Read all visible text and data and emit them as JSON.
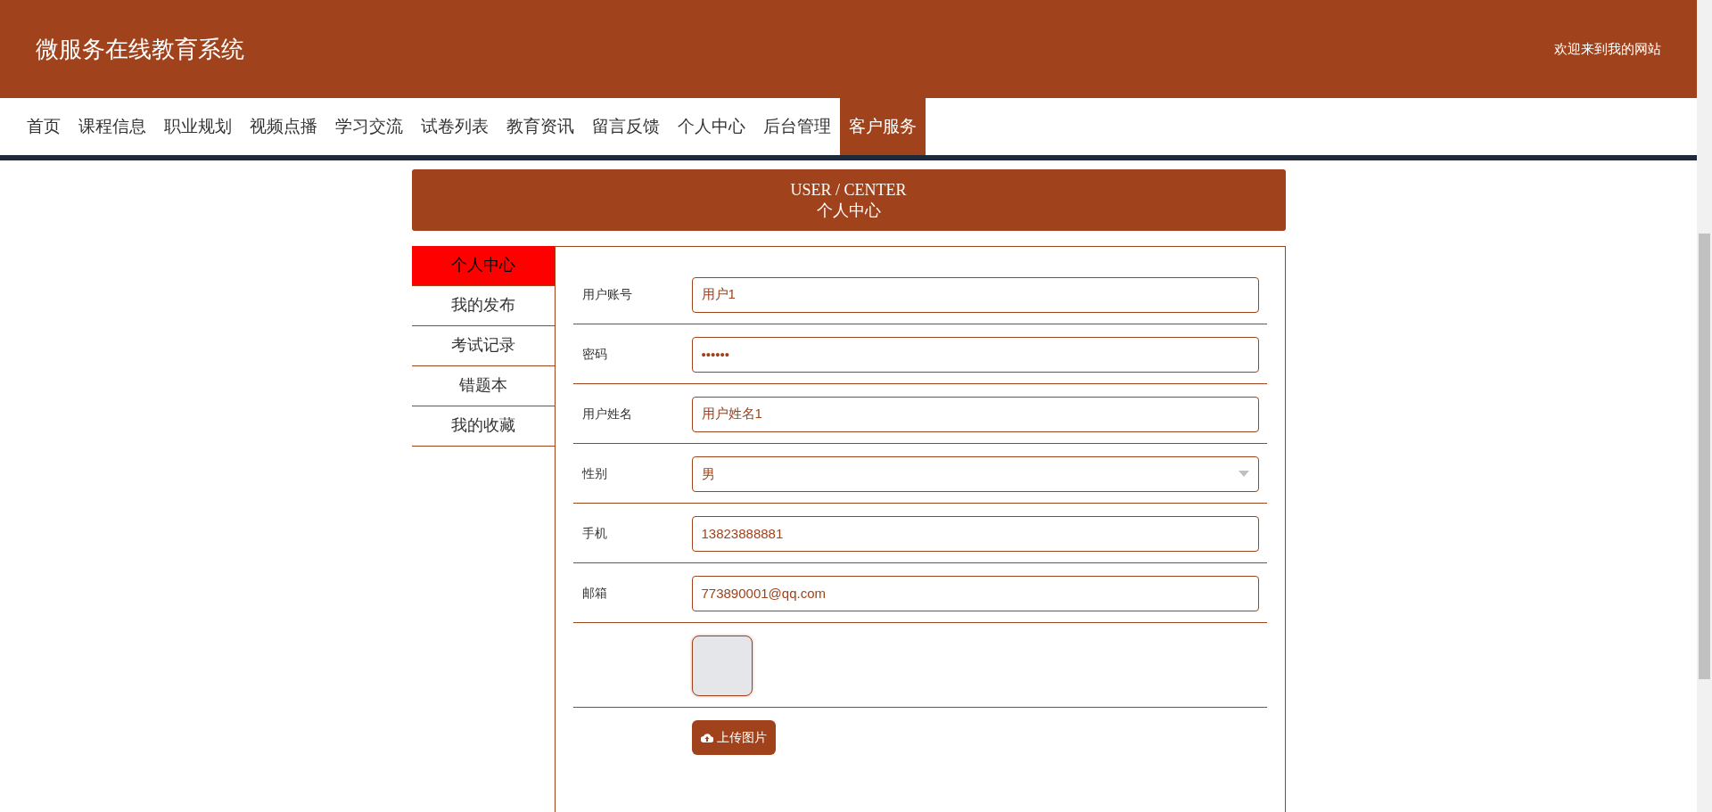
{
  "header": {
    "title": "微服务在线教育系统",
    "welcome": "欢迎来到我的网站"
  },
  "nav": [
    {
      "label": "首页",
      "selected": false
    },
    {
      "label": "课程信息",
      "selected": false
    },
    {
      "label": "职业规划",
      "selected": false
    },
    {
      "label": "视频点播",
      "selected": false
    },
    {
      "label": "学习交流",
      "selected": false
    },
    {
      "label": "试卷列表",
      "selected": false
    },
    {
      "label": "教育资讯",
      "selected": false
    },
    {
      "label": "留言反馈",
      "selected": false
    },
    {
      "label": "个人中心",
      "selected": false
    },
    {
      "label": "后台管理",
      "selected": false
    },
    {
      "label": "客户服务",
      "selected": true
    }
  ],
  "banner": {
    "title_en": "USER / CENTER",
    "title": "个人中心"
  },
  "sidebar": [
    {
      "label": "个人中心",
      "selected": true
    },
    {
      "label": "我的发布",
      "selected": false
    },
    {
      "label": "考试记录",
      "selected": false
    },
    {
      "label": "错题本",
      "selected": false
    },
    {
      "label": "我的收藏",
      "selected": false
    }
  ],
  "form": [
    {
      "kind": "text",
      "label": "用户账号",
      "value": "用户1"
    },
    {
      "kind": "text",
      "label": "密码",
      "value": "••••••"
    },
    {
      "kind": "text",
      "label": "用户姓名",
      "value": "用户姓名1"
    },
    {
      "kind": "select",
      "label": "性别",
      "value": "男"
    },
    {
      "kind": "text",
      "label": "手机",
      "value": "13823888881"
    },
    {
      "kind": "text",
      "label": "邮箱",
      "value": "773890001@qq.com"
    },
    {
      "kind": "image"
    },
    {
      "kind": "upload",
      "button": "上传图片"
    }
  ]
}
